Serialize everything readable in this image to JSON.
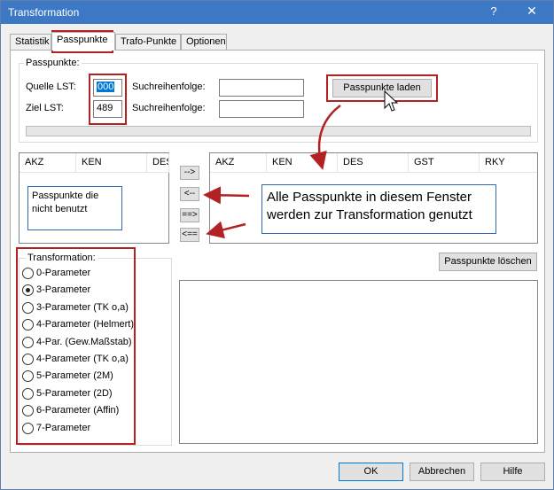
{
  "window": {
    "title": "Transformation",
    "help_glyph": "?",
    "close_glyph": "✕"
  },
  "tabs": [
    {
      "label": "Statistik"
    },
    {
      "label": "Passpunkte"
    },
    {
      "label": "Trafo-Punkte"
    },
    {
      "label": "Optionen"
    }
  ],
  "passpunkte": {
    "group_label": "Passpunkte:",
    "quelle_label": "Quelle LST:",
    "quelle_value": "000",
    "ziel_label": "Ziel LST:",
    "ziel_value": "489",
    "sort1_label": "Suchreihenfolge:",
    "sort1_value": "",
    "sort2_label": "Suchreihenfolge:",
    "sort2_value": "",
    "load_button": "Passpunkte laden"
  },
  "left_list": {
    "columns": [
      "AKZ",
      "KEN",
      "DES"
    ]
  },
  "right_list": {
    "columns": [
      "AKZ",
      "KEN",
      "DES",
      "GST",
      "RKY"
    ]
  },
  "transfer_buttons": [
    "-->",
    "<--",
    "==>",
    "<=="
  ],
  "annotations": {
    "unused_note": "Passpunkte die nicht benutzt",
    "used_note": "Alle Passpunkte in diesem Fenster werden zur Transformation genutzt"
  },
  "delete_button": "Passpunkte löschen",
  "transformation": {
    "group_label": "Transformation:",
    "selected_index": 1,
    "options": [
      "0-Parameter",
      "3-Parameter",
      "3-Parameter (TK o,a)",
      "4-Parameter (Helmert)",
      "4-Par. (Gew.Maßstab)",
      "4-Parameter (TK o,a)",
      "5-Parameter (2M)",
      "5-Parameter (2D)",
      "6-Parameter (Affin)",
      "7-Parameter"
    ]
  },
  "footer": {
    "ok": "OK",
    "cancel": "Abbrechen",
    "help": "Hilfe"
  },
  "colors": {
    "titlebar": "#3c78c4",
    "annotation_red": "#b22222",
    "selection": "#0078d7"
  }
}
